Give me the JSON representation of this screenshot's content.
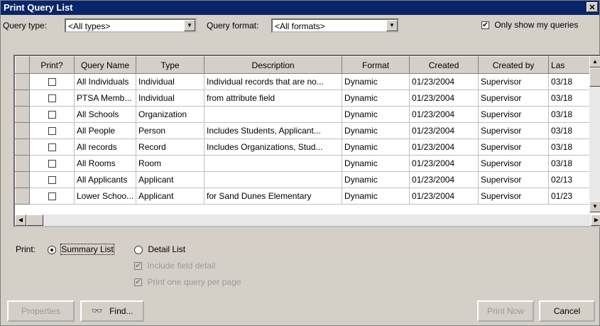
{
  "window": {
    "title": "Print Query List",
    "close_symbol": "✕"
  },
  "filters": {
    "query_type_label": "Query type:",
    "query_type_value": "<All types>",
    "query_format_label": "Query format:",
    "query_format_value": "<All formats>",
    "only_mine_label": "Only show my queries",
    "only_mine_checked": true
  },
  "table": {
    "columns": [
      "Print?",
      "Query Name",
      "Type",
      "Description",
      "Format",
      "Created",
      "Created by",
      "Las"
    ],
    "rows": [
      {
        "print": false,
        "name": "All Individuals",
        "type": "Individual",
        "description": "Individual records that are no...",
        "format": "Dynamic",
        "created": "01/23/2004",
        "created_by": "Supervisor",
        "last": "03/18"
      },
      {
        "print": false,
        "name": "PTSA Memb...",
        "type": "Individual",
        "description": "from attribute field",
        "format": "Dynamic",
        "created": "01/23/2004",
        "created_by": "Supervisor",
        "last": "03/18"
      },
      {
        "print": false,
        "name": "All Schools",
        "type": "Organization",
        "description": "",
        "format": "Dynamic",
        "created": "01/23/2004",
        "created_by": "Supervisor",
        "last": "03/18"
      },
      {
        "print": false,
        "name": "All People",
        "type": "Person",
        "description": "Includes Students, Applicant...",
        "format": "Dynamic",
        "created": "01/23/2004",
        "created_by": "Supervisor",
        "last": "03/18"
      },
      {
        "print": false,
        "name": "All records",
        "type": "Record",
        "description": "Includes Organizations, Stud...",
        "format": "Dynamic",
        "created": "01/23/2004",
        "created_by": "Supervisor",
        "last": "03/18"
      },
      {
        "print": false,
        "name": "All Rooms",
        "type": "Room",
        "description": "",
        "format": "Dynamic",
        "created": "01/23/2004",
        "created_by": "Supervisor",
        "last": "03/18"
      },
      {
        "print": false,
        "name": "All Applicants",
        "type": "Applicant",
        "description": "",
        "format": "Dynamic",
        "created": "01/23/2004",
        "created_by": "Supervisor",
        "last": "02/13"
      },
      {
        "print": false,
        "name": "Lower Schoo...",
        "type": "Applicant",
        "description": "for Sand Dunes Elementary",
        "format": "Dynamic",
        "created": "01/23/2004",
        "created_by": "Supervisor",
        "last": "01/23"
      }
    ]
  },
  "print_options": {
    "print_label": "Print:",
    "summary_label": "Summary List",
    "detail_label": "Detail List",
    "selected": "summary",
    "include_field_detail_label": "Include field detail",
    "one_per_page_label": "Print one query per page"
  },
  "buttons": {
    "properties": "Properties",
    "find": "Find...",
    "print_now": "Print Now",
    "cancel": "Cancel"
  },
  "glyphs": {
    "check": "✔",
    "down": "▼",
    "up": "▲",
    "left": "◀",
    "right": "▶",
    "binoculars": "👓"
  }
}
